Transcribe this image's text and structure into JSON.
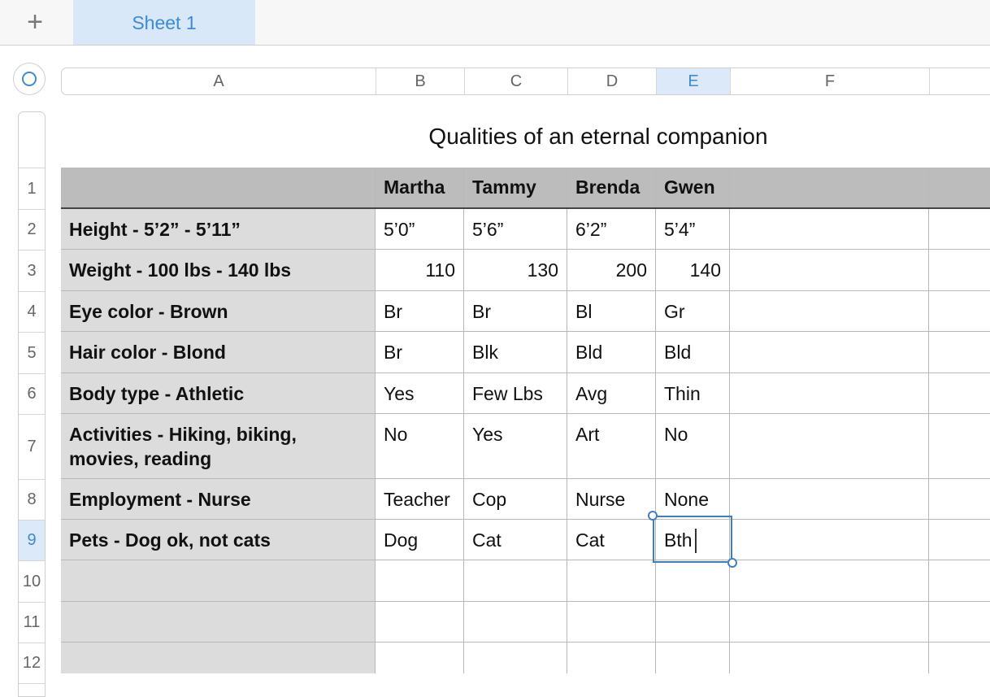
{
  "tabbar": {
    "add_icon": "plus-icon",
    "add_glyph": "+",
    "sheet_tab": "Sheet 1"
  },
  "columns": [
    "A",
    "B",
    "C",
    "D",
    "E",
    "F",
    ""
  ],
  "selected_column": "E",
  "rows": [
    "",
    "1",
    "2",
    "3",
    "4",
    "5",
    "6",
    "7",
    "8",
    "9",
    "10",
    "11",
    "12"
  ],
  "selected_row": "9",
  "table": {
    "title": "Qualities of an eternal companion",
    "header": [
      "",
      "Martha",
      "Tammy",
      "Brenda",
      "Gwen",
      "",
      ""
    ],
    "body": [
      [
        "Height - 5’2” - 5’11”",
        "5’0”",
        "5’6”",
        "6’2”",
        "5’4”",
        "",
        ""
      ],
      [
        "Weight - 100 lbs - 140 lbs",
        "110",
        "130",
        "200",
        "140",
        "",
        ""
      ],
      [
        "Eye color - Brown",
        "Br",
        "Br",
        "Bl",
        "Gr",
        "",
        ""
      ],
      [
        "Hair color - Blond",
        "Br",
        "Blk",
        "Bld",
        "Bld",
        "",
        ""
      ],
      [
        "Body type - Athletic",
        "Yes",
        "Few Lbs",
        "Avg",
        "Thin",
        "",
        ""
      ],
      [
        "Activities - Hiking, biking, movies, reading",
        "No",
        "Yes",
        "Art",
        "No",
        "",
        ""
      ],
      [
        "Employment - Nurse",
        "Teacher",
        "Cop",
        "Nurse",
        "None",
        "",
        ""
      ],
      [
        "Pets - Dog ok, not cats",
        "Dog",
        "Cat",
        "Cat",
        "Bth",
        "",
        ""
      ],
      [
        "",
        "",
        "",
        "",
        "",
        "",
        ""
      ],
      [
        "",
        "",
        "",
        "",
        "",
        "",
        ""
      ],
      [
        "",
        "",
        "",
        "",
        "",
        "",
        ""
      ]
    ],
    "editing_cell": "E9"
  },
  "colors": {
    "accent": "#3d8ad6",
    "header_fill": "#bcbcbc",
    "row_label_fill": "#dcdcdc"
  }
}
